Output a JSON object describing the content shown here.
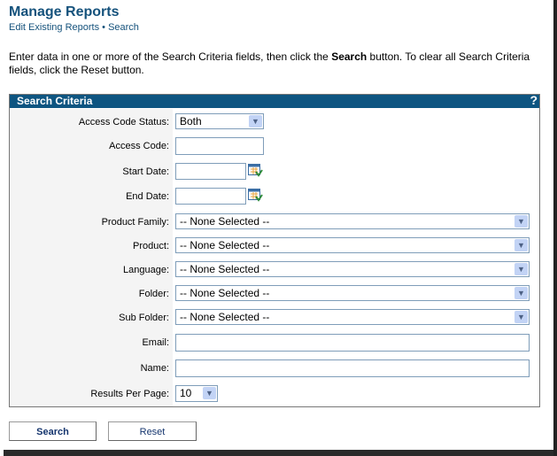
{
  "header": {
    "title": "Manage Reports",
    "breadcrumb": "Edit Existing Reports • Search"
  },
  "intro": {
    "part1": "Enter data in one or more of the Search Criteria fields, then click the ",
    "bold": "Search",
    "part2": " button. To clear all Search Criteria fields, click the Reset",
    "line2": "button."
  },
  "panel": {
    "title": "Search Criteria",
    "help": "?"
  },
  "fields": {
    "access_code_status": {
      "label": "Access Code Status:",
      "value": "Both"
    },
    "access_code": {
      "label": "Access Code:",
      "value": ""
    },
    "start_date": {
      "label": "Start Date:",
      "value": ""
    },
    "end_date": {
      "label": "End Date:",
      "value": ""
    },
    "product_family": {
      "label": "Product Family:",
      "value": "-- None Selected --"
    },
    "product": {
      "label": "Product:",
      "value": "-- None Selected --"
    },
    "language": {
      "label": "Language:",
      "value": "-- None Selected --"
    },
    "folder": {
      "label": "Folder:",
      "value": "-- None Selected --"
    },
    "sub_folder": {
      "label": "Sub Folder:",
      "value": "-- None Selected --"
    },
    "email": {
      "label": "Email:",
      "value": ""
    },
    "name": {
      "label": "Name:",
      "value": ""
    },
    "results_per_page": {
      "label": "Results Per Page:",
      "value": "10"
    }
  },
  "buttons": {
    "search": "Search",
    "reset": "Reset"
  },
  "colors": {
    "brand": "#0e5581",
    "title": "#15527c"
  },
  "icons": {
    "calendar": "calendar-icon",
    "dropdown": "chevron-down-icon"
  }
}
